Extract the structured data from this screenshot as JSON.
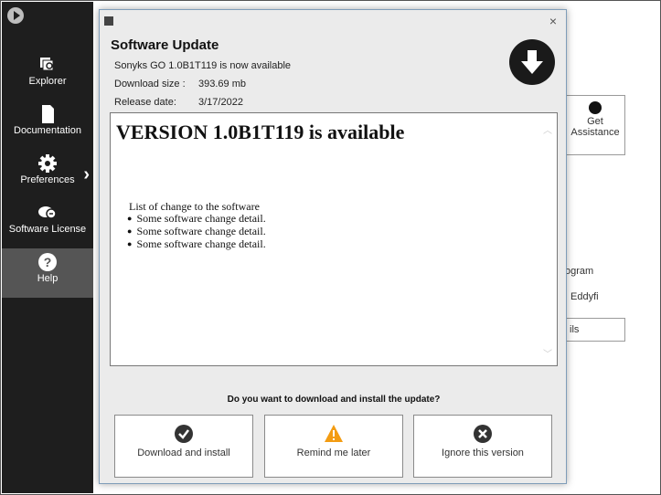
{
  "sidebar": {
    "items": [
      {
        "label": "Explorer",
        "icon": "explorer-icon"
      },
      {
        "label": "Documentation",
        "icon": "document-icon"
      },
      {
        "label": "Preferences",
        "icon": "gear-icon"
      },
      {
        "label": "Software License",
        "icon": "license-icon"
      },
      {
        "label": "Help",
        "icon": "help-icon",
        "active": true
      }
    ],
    "colors": {
      "background": "#1e1e1e",
      "active": "#555555"
    }
  },
  "background_app": {
    "assistance_button": {
      "line1": "Get",
      "line2": "Assistance"
    },
    "partial_texts": [
      "ogram",
      "Eddyfi"
    ],
    "partial_button": "ils"
  },
  "dialog": {
    "close_glyph": "×",
    "title": "Software Update",
    "subtitle": "Sonyks GO 1.0B1T119 is now available",
    "download_size_label": "Download size :",
    "download_size_value": "393.69 mb",
    "release_date_label": "Release date:",
    "release_date_value": "3/17/2022",
    "notes": {
      "heading": "VERSION 1.0B1T119 is available",
      "list_title": "List of change to the software",
      "items": [
        "Some software change detail.",
        "Some software change detail.",
        "Some software change detail."
      ]
    },
    "question": "Do you want to download and install the update?",
    "actions": {
      "download": {
        "label": "Download and install",
        "icon": "check-circle-icon",
        "color": "#333333"
      },
      "remind": {
        "label": "Remind me later",
        "icon": "warning-icon",
        "color": "#f39c12"
      },
      "ignore": {
        "label": "Ignore this version",
        "icon": "close-circle-icon",
        "color": "#333333"
      }
    }
  }
}
